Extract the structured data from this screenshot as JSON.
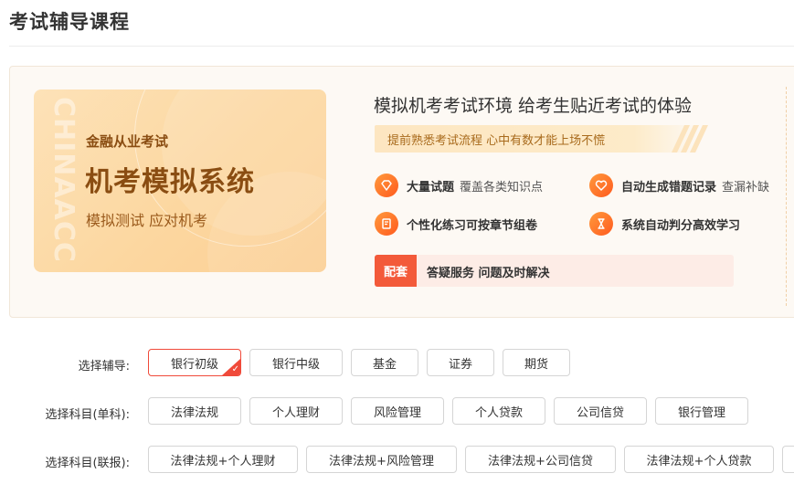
{
  "page": {
    "title": "考试辅导课程"
  },
  "hero": {
    "watermark": "CHINAACC",
    "subtitle": "金融从业考试",
    "title": "机考模拟系统",
    "tagline": "模拟测试 应对机考"
  },
  "intro": {
    "headline": "模拟机考考试环境 给考生贴近考试的体验",
    "ribbon": "提前熟悉考试流程 心中有数才能上场不慌"
  },
  "features": [
    {
      "title": "大量试题",
      "desc": "覆盖各类知识点",
      "icon": "diamond-icon"
    },
    {
      "title": "自动生成错题记录",
      "desc": "查漏补缺",
      "icon": "heart-icon"
    },
    {
      "title": "个性化练习可按章节组卷",
      "desc": "",
      "icon": "document-icon"
    },
    {
      "title": "系统自动判分高效学习",
      "desc": "",
      "icon": "hourglass-icon"
    }
  ],
  "service": {
    "badge": "配套",
    "text": "答疑服务 问题及时解决"
  },
  "filters": {
    "counseling": {
      "label": "选择辅导:",
      "options": [
        "银行初级",
        "银行中级",
        "基金",
        "证券",
        "期货"
      ],
      "selected": "银行初级"
    },
    "single_subject": {
      "label": "选择科目(单科):",
      "options": [
        "法律法规",
        "个人理财",
        "风险管理",
        "个人贷款",
        "公司信贷",
        "银行管理"
      ]
    },
    "combined_subject": {
      "label": "选择科目(联报):",
      "options": [
        "法律法规+个人理财",
        "法律法规+风险管理",
        "法律法规+公司信贷",
        "法律法规+个人贷款"
      ]
    }
  },
  "colors": {
    "accent": "#f04a3a",
    "gold": "#8a4d12",
    "orange": "#ff7a2e"
  }
}
